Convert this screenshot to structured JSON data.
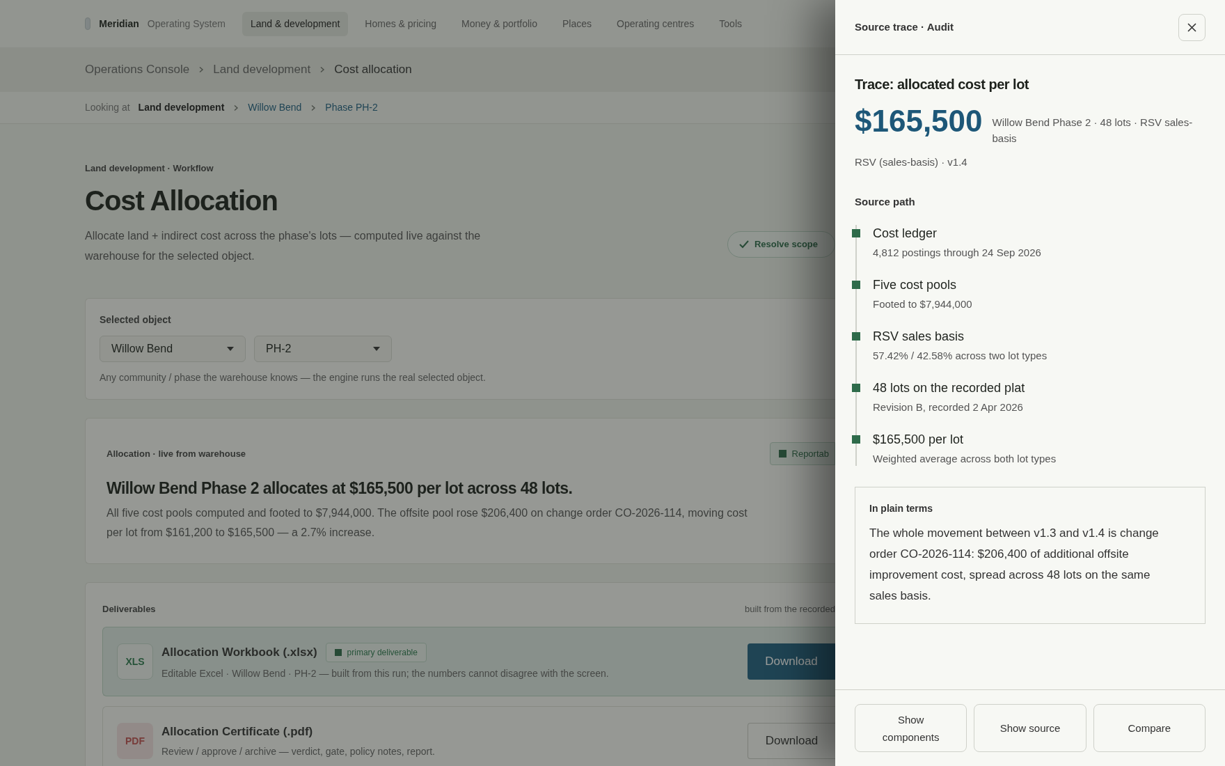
{
  "nav": {
    "brand": "Meridian",
    "product": "Operating System",
    "items": [
      {
        "label": "Land & development",
        "selected": true
      },
      {
        "label": "Homes & pricing",
        "selected": false
      },
      {
        "label": "Money & portfolio",
        "selected": false
      },
      {
        "label": "Places",
        "selected": false
      },
      {
        "label": "Operating centres",
        "selected": false
      },
      {
        "label": "Tools",
        "selected": false
      }
    ]
  },
  "breadcrumb": [
    "Operations Console",
    "Land development",
    "Cost allocation"
  ],
  "looking_at": {
    "label": "Looking at",
    "items": [
      {
        "label": "Land development",
        "kind": "plain"
      },
      {
        "label": "Willow Bend",
        "kind": "link"
      },
      {
        "label": "Phase PH-2",
        "kind": "link"
      }
    ]
  },
  "page": {
    "eyebrow": "Land development · Workflow",
    "title": "Cost Allocation",
    "description": "Allocate land + indirect cost across the phase's lots — computed live against the warehouse for the selected object.",
    "resolve_button": "Resolve scope"
  },
  "selected_object": {
    "label": "Selected object",
    "community": "Willow Bend",
    "phase": "PH-2",
    "hint": "Any community / phase the warehouse knows — the engine runs the real selected object."
  },
  "allocation": {
    "eyebrow": "Allocation · live from warehouse",
    "badge": "Reportab",
    "headline": "Willow Bend Phase 2 allocates at $165,500 per lot across 48 lots.",
    "lines": [
      "All five cost pools computed and footed to $7,944,000. The offsite pool rose $206,400 on change order CO-2026-114, moving cost",
      "per lot from $161,200 to $165,500 — a 2.7% increase."
    ]
  },
  "deliverables": {
    "title": "Deliverables",
    "note": "built from the recorded",
    "items": [
      {
        "kind": "xls",
        "icon_label": "XLS",
        "title": "Allocation Workbook (.xlsx)",
        "tag": "primary deliverable",
        "description": "Editable Excel · Willow Bend · PH-2 — built from this run; the numbers cannot disagree with the screen.",
        "button": "Download",
        "primary": true
      },
      {
        "kind": "pdf",
        "icon_label": "PDF",
        "title": "Allocation Certificate (.pdf)",
        "description": "Review / approve / archive — verdict, gate, policy notes, report.",
        "button": "Download",
        "primary": false
      }
    ]
  },
  "panel": {
    "header": "Source trace · Audit",
    "title": "Trace: allocated cost per lot",
    "value": "$165,500",
    "value_note": "Willow Bend Phase 2 · 48 lots · RSV sales-basis",
    "method": "RSV (sales-basis) · v1.4",
    "path_title": "Source path",
    "path": [
      {
        "title": "Cost ledger",
        "detail": "4,812 postings through 24 Sep 2026"
      },
      {
        "title": "Five cost pools",
        "detail": "Footed to $7,944,000"
      },
      {
        "title": "RSV sales basis",
        "detail": "57.42% / 42.58% across two lot types"
      },
      {
        "title": "48 lots on the recorded plat",
        "detail": "Revision B, recorded 2 Apr 2026"
      },
      {
        "title": "$165,500 per lot",
        "detail": "Weighted average across both lot types"
      }
    ],
    "plain_title": "In plain terms",
    "plain_text": "The whole movement between v1.3 and v1.4 is change order CO-2026-114: $206,400 of additional offsite improvement cost, spread across 48 lots on the same sales basis.",
    "buttons": [
      "Show components",
      "Show source",
      "Compare"
    ]
  }
}
